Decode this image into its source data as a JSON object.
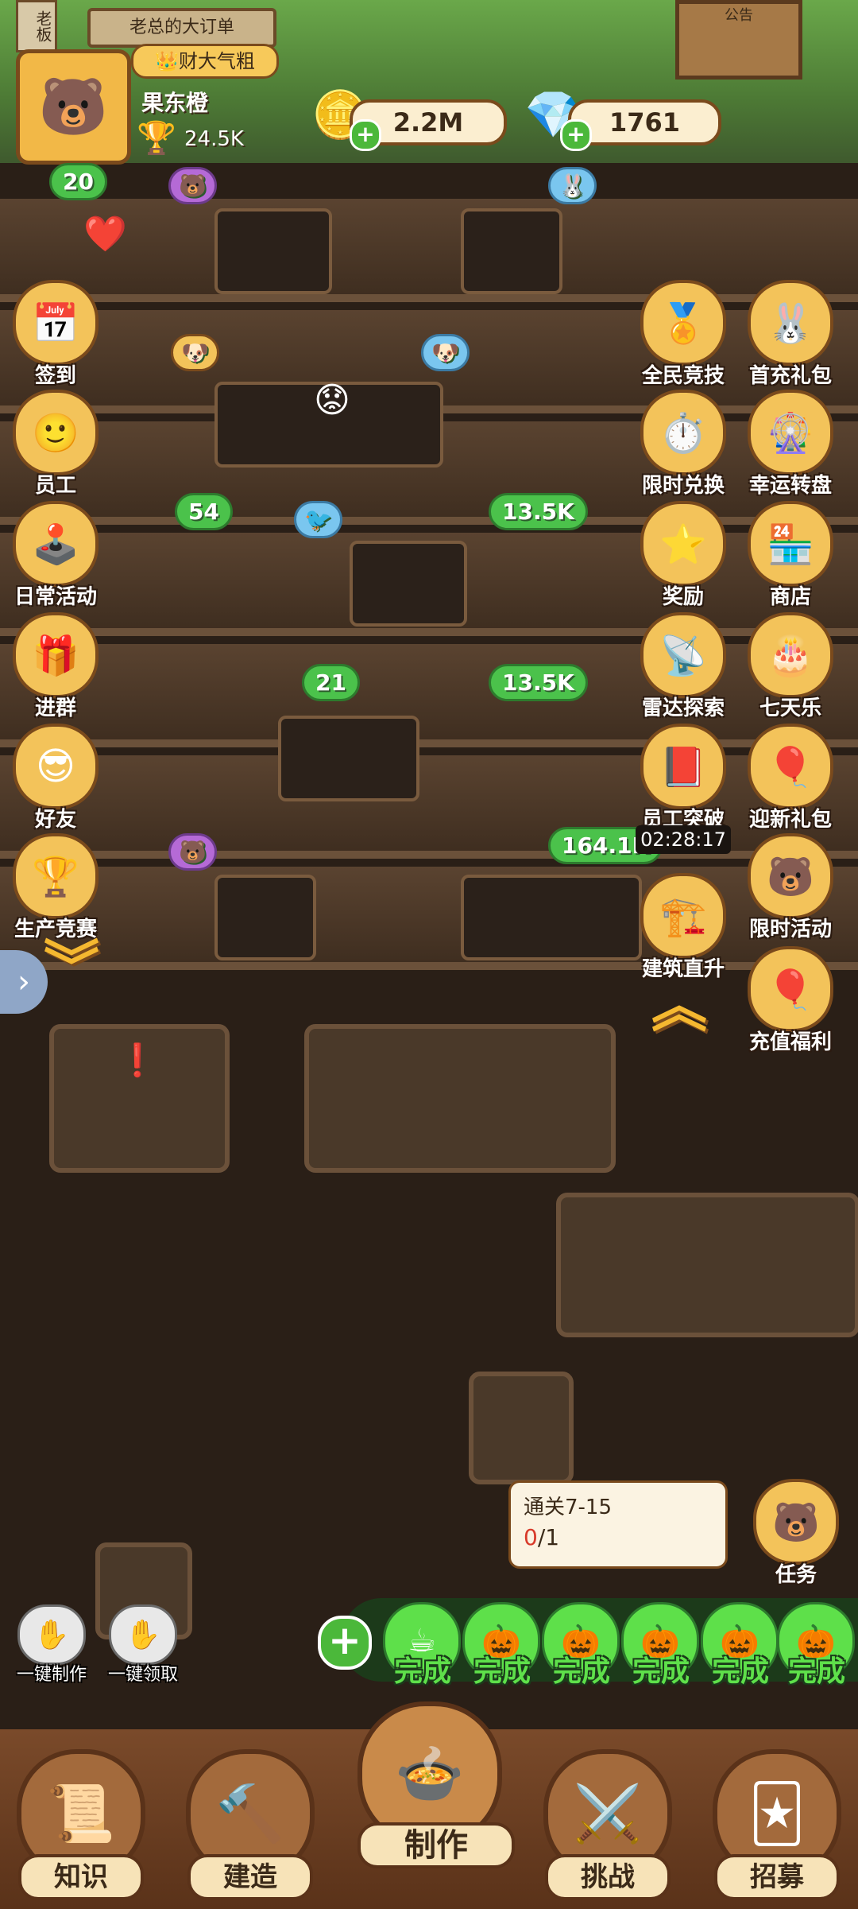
{
  "header": {
    "boss_sign": "老板",
    "order_sign": "老总的大订单",
    "notice_sign": "公告",
    "title_badge": "财大气粗",
    "player_name": "果东橙",
    "trophy": "24.5K",
    "coins": "2.2M",
    "gems": "1761"
  },
  "floor_bubbles": [
    {
      "value": "20"
    },
    {
      "value": "54"
    },
    {
      "value": "13.5K"
    },
    {
      "value": "21"
    },
    {
      "value": "13.5K"
    },
    {
      "value": "164.1K"
    }
  ],
  "left_menu": [
    {
      "label": "签到",
      "icon": "calendar-icon"
    },
    {
      "label": "员工",
      "icon": "staff-icon"
    },
    {
      "label": "日常活动",
      "icon": "arcade-icon"
    },
    {
      "label": "进群",
      "icon": "gift-icon"
    },
    {
      "label": "好友",
      "icon": "friends-icon"
    },
    {
      "label": "生产竞赛",
      "icon": "trophy-icon"
    }
  ],
  "right_menu": [
    {
      "label": "全民竞技",
      "icon": "trophy-icon"
    },
    {
      "label": "首充礼包",
      "icon": "gift-icon"
    },
    {
      "label": "限时兑换",
      "icon": "stopwatch-icon"
    },
    {
      "label": "幸运转盘",
      "icon": "wheel-icon"
    },
    {
      "label": "奖励",
      "icon": "star-icon"
    },
    {
      "label": "商店",
      "icon": "shop-icon"
    },
    {
      "label": "雷达探索",
      "icon": "radar-icon"
    },
    {
      "label": "七天乐",
      "icon": "cake-icon"
    },
    {
      "label": "员工突破",
      "icon": "book-icon"
    },
    {
      "label": "迎新礼包",
      "icon": "welcome-icon"
    },
    {
      "label": "建筑直升",
      "icon": "building-icon"
    },
    {
      "label": "限时活动",
      "icon": "bear-icon"
    },
    {
      "label": "充值福利",
      "icon": "balloon-icon"
    }
  ],
  "timer": "02:28:17",
  "task": {
    "title": "通关7-15",
    "progress_current": "0",
    "progress_total": "/1",
    "label": "任务"
  },
  "quick_actions": {
    "make_all": "一键制作",
    "collect_all": "一键领取"
  },
  "production_queue": [
    {
      "status": "完成"
    },
    {
      "status": "完成"
    },
    {
      "status": "完成"
    },
    {
      "status": "完成"
    },
    {
      "status": "完成"
    },
    {
      "status": "完成"
    }
  ],
  "bottom_nav": [
    {
      "label": "知识"
    },
    {
      "label": "建造"
    },
    {
      "label": "制作"
    },
    {
      "label": "挑战"
    },
    {
      "label": "招募"
    }
  ]
}
